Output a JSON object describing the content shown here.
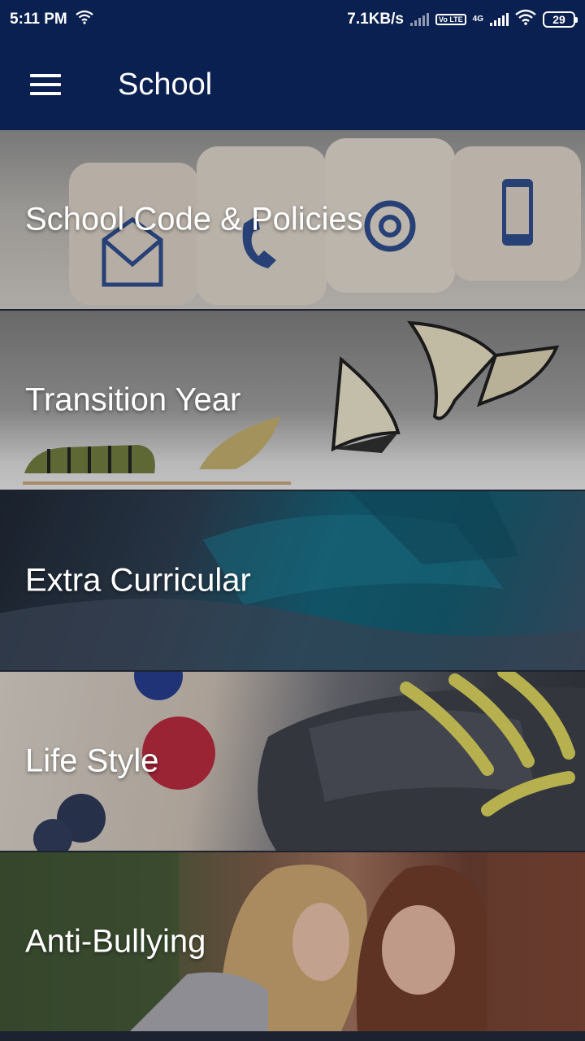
{
  "status_bar": {
    "time": "5:11 PM",
    "net_speed": "7.1KB/s",
    "volte": "Vo LTE",
    "network_type": "4G",
    "battery": "29"
  },
  "app_bar": {
    "title": "School",
    "menu_icon": "hamburger-menu-icon"
  },
  "categories": [
    {
      "label": "School Code & Policies"
    },
    {
      "label": "Transition Year"
    },
    {
      "label": "Extra Curricular"
    },
    {
      "label": "Life Style"
    },
    {
      "label": "Anti-Bullying"
    }
  ],
  "colors": {
    "primary": "#0a2050",
    "text_on_primary": "#ffffff"
  }
}
